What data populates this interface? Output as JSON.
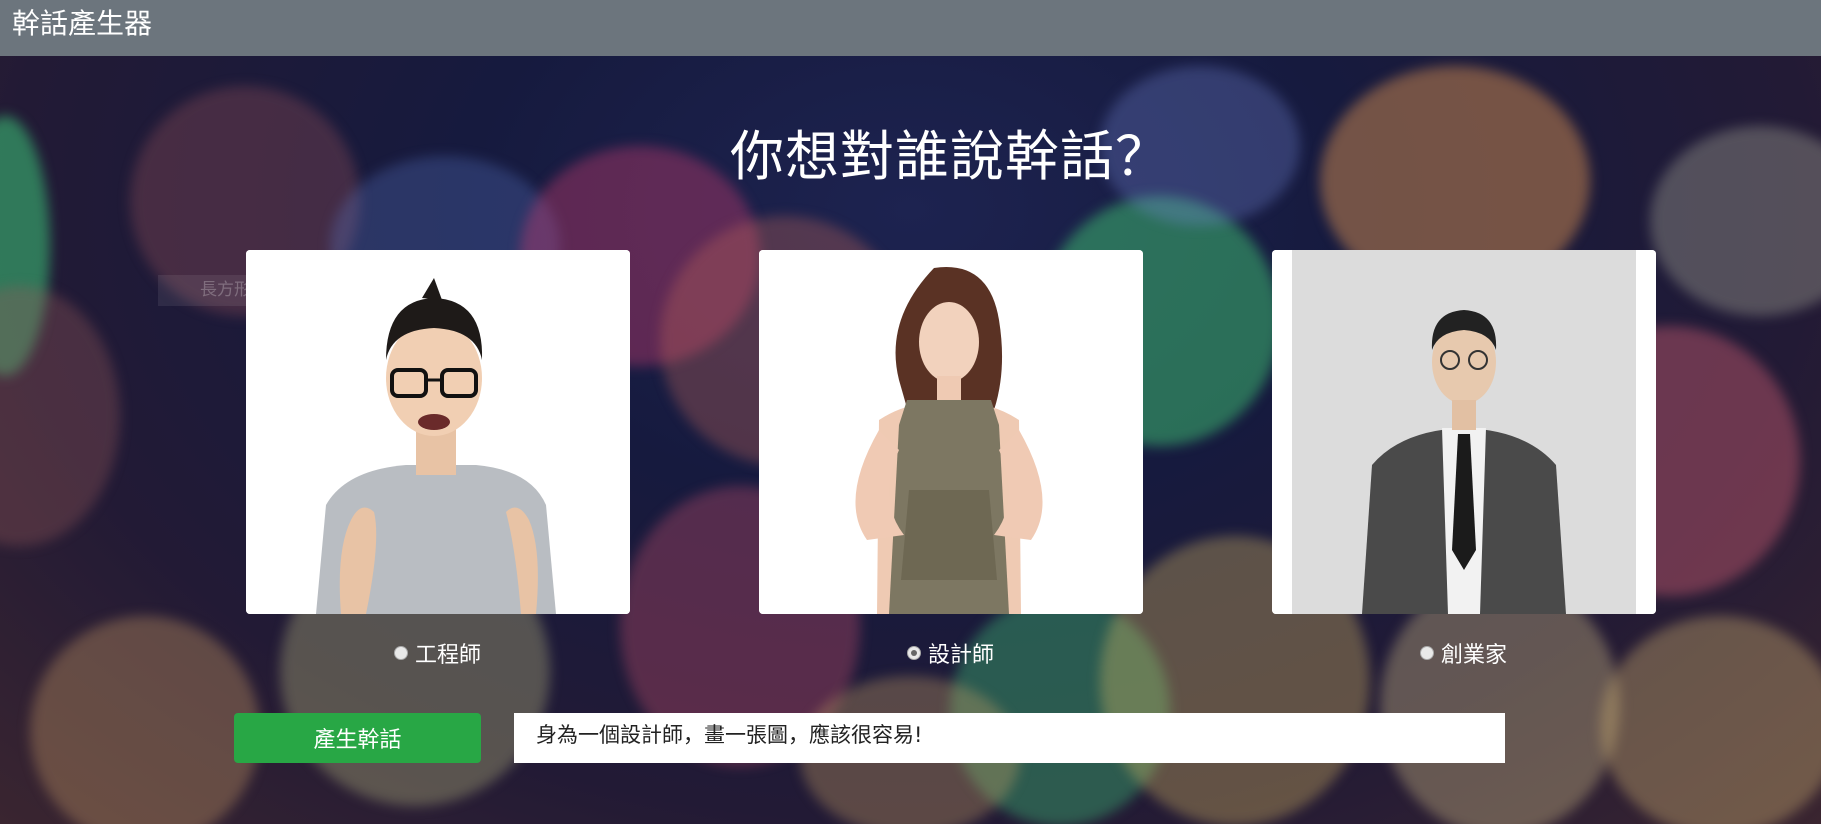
{
  "app": {
    "title": "幹話產生器"
  },
  "main": {
    "heading": "你想對誰說幹話？",
    "ghost_menu_item": "長方形剪取(R)",
    "options": [
      {
        "label": "工程師",
        "selected": false
      },
      {
        "label": "設計師",
        "selected": true
      },
      {
        "label": "創業家",
        "selected": false
      }
    ],
    "generate_button": "產生幹話",
    "output_text": "身為一個設計師，畫一張圖，應該很容易!"
  },
  "colors": {
    "navbar": "#6c757d",
    "button": "#28a745",
    "card": "#ffffff"
  }
}
